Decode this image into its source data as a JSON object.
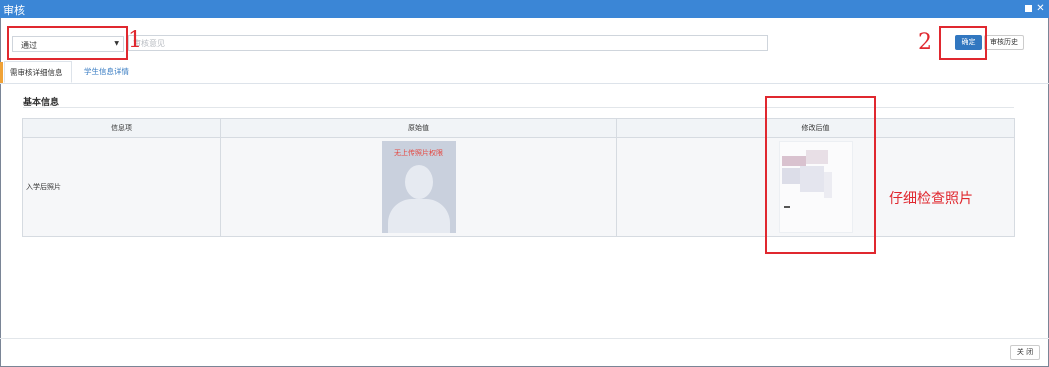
{
  "window": {
    "title": "审核"
  },
  "toolbar": {
    "result_select": {
      "value": "通过"
    },
    "comment": {
      "placeholder": "审核意见"
    },
    "confirm_label": "确定",
    "history_label": "审核历史"
  },
  "tabs": [
    {
      "label": "需审核详细信息",
      "active": true
    },
    {
      "label": "学生信息详情",
      "active": false
    }
  ],
  "section": {
    "title": "基本信息"
  },
  "table": {
    "headers": [
      "信息项",
      "原始值",
      "修改后值"
    ],
    "rows": [
      {
        "item": "入学后照片",
        "original_note": "无上传照片权限"
      }
    ]
  },
  "annotations": {
    "step1": "1",
    "step2": "2",
    "note": "仔细检查照片"
  },
  "footer": {
    "close_label": "关 闭"
  },
  "colors": {
    "titlebar": "#3b86d6",
    "primary_button": "#3177c0",
    "annotation": "#e0282f"
  }
}
